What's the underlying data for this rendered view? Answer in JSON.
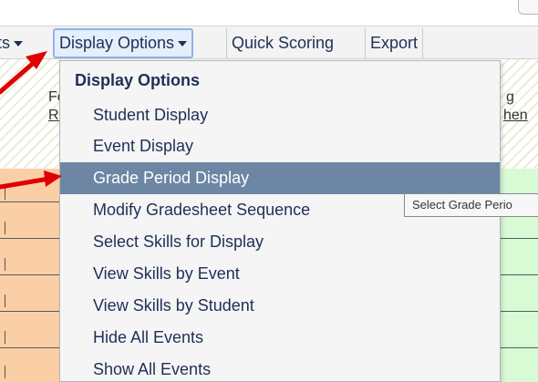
{
  "menubar": {
    "prev_fragment": "ts",
    "display_options": "Display Options",
    "quick_scoring": "Quick Scoring",
    "export": "Export"
  },
  "background_fragments": {
    "left_line1": "Fo",
    "left_line2": "Re",
    "right_line1": "g",
    "right_line2": "hen"
  },
  "dropdown": {
    "header": "Display Options",
    "items": [
      "Student Display",
      "Event Display",
      "Grade Period Display",
      "Modify Gradesheet Sequence",
      "Select Skills for Display",
      "View Skills by Event",
      "View Skills by Student",
      "Hide All Events",
      "Show All Events"
    ],
    "highlighted_index": 2
  },
  "tooltip": {
    "text": "Select Grade Perio"
  },
  "colors": {
    "highlight": "#6d86a4",
    "menu_text": "#1f2f55",
    "arrow": "#e00000",
    "peach": "#fbcfa6",
    "green": "#d8fbd6"
  },
  "icons": {
    "menu_caret": "caret-down-icon",
    "annotation": "red-arrow-icon"
  }
}
